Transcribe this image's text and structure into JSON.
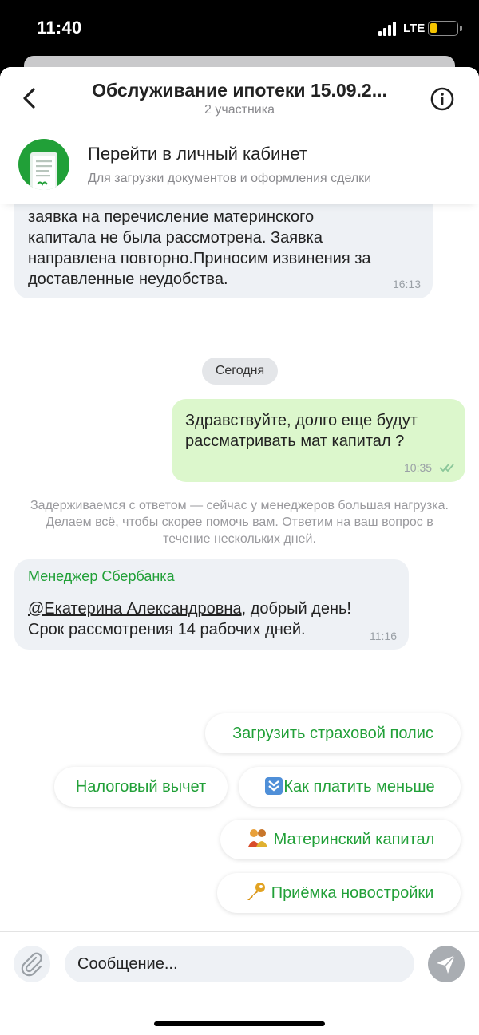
{
  "status_bar": {
    "time": "11:40",
    "network": "LTE"
  },
  "header": {
    "title": "Обслуживание ипотеки 15.09.2...",
    "subtitle": "2 участника"
  },
  "banner": {
    "title": "Перейти в личный кабинет",
    "subtitle": "Для загрузки документов и оформления сделки"
  },
  "messages": {
    "first": {
      "lines": [
        "заявка на перечисление материнского",
        "капитала не была рассмотрена.  Заявка",
        "направлена повторно.Приносим извинения за",
        "доставленные неудобства."
      ],
      "time": "16:13"
    },
    "date_separator": "Сегодня",
    "outgoing": {
      "lines": [
        "Здравствуйте, долго еще будут",
        "рассматривать мат капитал ?"
      ],
      "time": "10:35"
    },
    "system_note": "Задерживаемся с ответом — сейчас у менеджеров большая нагрузка. Делаем всё, чтобы скорее помочь вам. Ответим на ваш вопрос в течение нескольких дней.",
    "reply": {
      "sender": "Менеджер Сбербанка",
      "mention": "@Екатерина Александровна",
      "line1_rest": ",  добрый день!",
      "line2": "Срок рассмотрения 14 рабочих дней.",
      "time": "11:16"
    }
  },
  "quick_replies": {
    "upload_policy": "Загрузить страховой полис",
    "tax_deduction": "Налоговый вычет",
    "pay_less": "Как платить меньше",
    "maternity_capital": "Материнский капитал",
    "new_building": "Приёмка новостройки"
  },
  "input": {
    "placeholder": "Сообщение..."
  },
  "colors": {
    "accent": "#21a038",
    "outgoing_bubble": "#dcf7cc",
    "incoming_bubble": "#eef1f5"
  }
}
